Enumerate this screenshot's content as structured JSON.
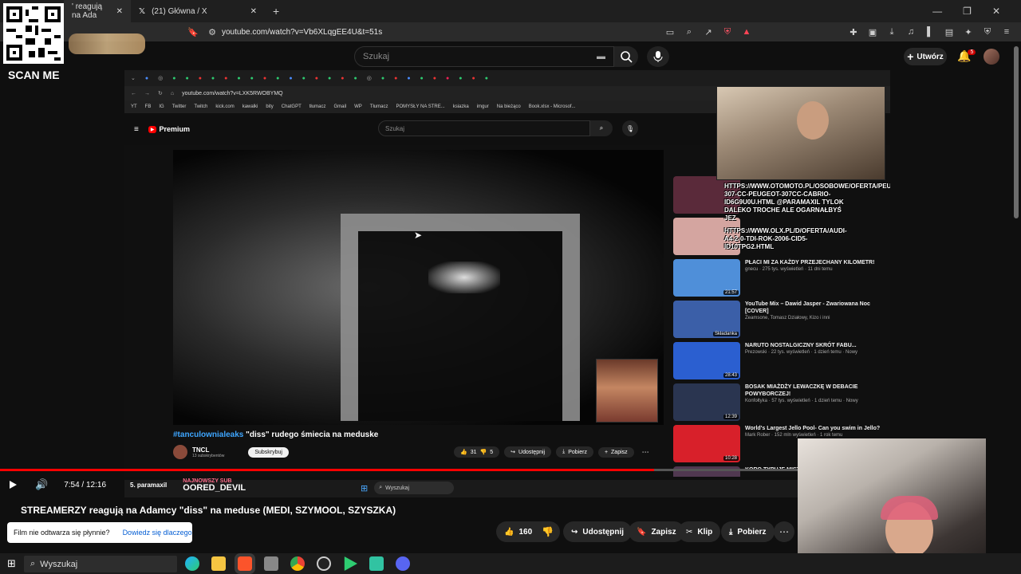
{
  "browser": {
    "tabs": [
      {
        "label": "' reagują na Ada"
      },
      {
        "label": "(21) Główna / X"
      }
    ],
    "url": "youtube.com/watch?v=Vb6XLqgEE4U&t=51s"
  },
  "overlay": {
    "scan_me": "SCAN ME"
  },
  "youtube": {
    "search_placeholder": "Szukaj",
    "create_label": "Utwórz",
    "notif_count": "5"
  },
  "inner": {
    "url": "youtube.com/watch?v=LXK5RWOBYMQ",
    "bookmarks": [
      "YT",
      "FB",
      "IG",
      "Twitter",
      "Twitch",
      "kick.com",
      "kawalki",
      "bity",
      "ChatGPT",
      "tłumacz",
      "Gmail",
      "WP",
      "Tłumacz",
      "POMYSŁY NA STRE...",
      "ksiazka",
      "imgur",
      "Na bieżąco",
      "Book.xlsx - Microsof..."
    ],
    "logo": "Premium",
    "search_placeholder": "Szukaj",
    "video_title_tag": "#tanculownialeaks",
    "video_title_rest": " \"diss\" rudego śmiecia na meduske",
    "channel": "TNCL",
    "channel_subs": "13 subskrybentów",
    "subscribe": "Subskrybuj",
    "likes": "31",
    "dislikes": "5",
    "share": "Udostępnij",
    "download": "Pobierz",
    "save": "Zapisz",
    "recs": [
      {
        "title": "",
        "meta": "11.06 20:00",
        "duration": ""
      },
      {
        "title": "",
        "meta": "",
        "duration": ""
      },
      {
        "title": "PŁACI MI ZA KAŻDY PRZEJECHANY KILOMETR!",
        "meta": "gnecu · 275 tys. wyświetleń · 11 dni temu",
        "duration": "21:57"
      },
      {
        "title": "YouTube Mix – Dawid Jasper - Zwariowana Noc [COVER]",
        "meta": "Zeamsone, Tomasz Działowy, Kizo i inni",
        "duration": "Składanka"
      },
      {
        "title": "NARUTO NOSTALGICZNY SKRÓT FABU...",
        "meta": "Prezowski · 22 tys. wyświetleń · 1 dzień temu · Nowy",
        "duration": "28:43"
      },
      {
        "title": "BOSAK MIAŻDŻY LEWACZKĘ W DEBACIE POWYBORCZEJ!",
        "meta": "Konfołtyka · 57 tys. wyświetleń · 1 dzień temu · Nowy",
        "duration": "12:39"
      },
      {
        "title": "World's Largest Jello Pool- Can you swim in Jello?",
        "meta": "Mark Rober · 152 mln wyświetleń · 1 rok temu",
        "duration": "10:28"
      },
      {
        "title": "KORO TYPUJE MISTRZ EUROPY | Kornel Pryz",
        "meta": "",
        "duration": ""
      }
    ],
    "overlay1": "HTTPS://WWW.OTOMOTO.PL/OSOBOWE/OFERTA/PEUGEOT-307-CC-PEUGEOT-307CC-CABRIO-ID6G9U0U.HTML @PARAMAXIL TYLOK DALEKO TROCHE ALE OGARNAŁBYŚ JEZ",
    "overlay2": "HTTPS://WWW.OLX.PL/D/OFERTA/AUDI-A4-2-0-TDI-ROK-2006-CID5-ID10TPG2.HTML",
    "taskbar_search": "Wyszukaj"
  },
  "player": {
    "time": "7:54 / 12:16",
    "chapter": "5. paramaxil",
    "sub_label": "NAJNOWSZY SUB",
    "sub_name": "OORED_DEVIL",
    "progress": 0.82
  },
  "video": {
    "title": "STREAMERZY reagują na Adamcy \"diss\" na meduse (MEDI, SZYMOOL, SZYSZKA)",
    "likes": "160",
    "share": "Udostępnij",
    "save": "Zapisz",
    "clip": "Klip",
    "download": "Pobierz"
  },
  "hint": {
    "text": "Film nie odtwarza się płynnie?",
    "link": "Dowiedz się dlaczego"
  },
  "taskbar": {
    "search_placeholder": "Wyszukaj"
  }
}
